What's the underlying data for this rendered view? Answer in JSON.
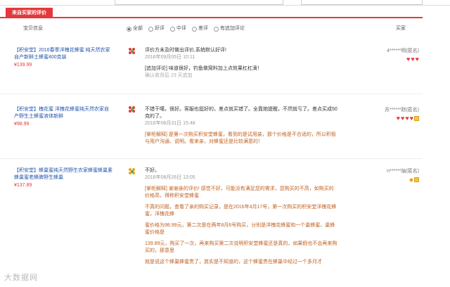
{
  "tab": {
    "label": "来自买家的评价"
  },
  "header": {
    "product_info": "宝贝信息",
    "filters": [
      "全部",
      "好评",
      "中评",
      "差评",
      "有追加评论"
    ],
    "buyer": "买家"
  },
  "reviews": [
    {
      "product_title": "【积安堂】2016春季洋槐花蜂蜜 纯天然农家自产新鲜土蜂蜜400克装",
      "price": "¥139.99",
      "text": "评价方未及时做出评价,系统默认好评!",
      "date": "2016年09月05日 10:11",
      "followup_label": "[追加评论] 味道很好，钓鱼做窝料加上点效果杠杠滴！",
      "followup_meta": "确认收货后 23 天追加",
      "user": "4******明(匿名)"
    },
    {
      "product_title": "【积安堂】槐花蜜 洋槐花蜂蜜纯天然农家自产野生土蜂蜜液体新鲜",
      "price": "¥98.99",
      "text": "不错干噶，很好。客服也挺好的，差点就买错了。全靠她提醒，不然就亏了。差点买成50克的了。",
      "date": "2016年08月31日 15:48",
      "reply": "[掌柜解释] 是第一次购买积安堂蜂蜜，看到的是试用装，那个价格是不合适的，所以积极与用户沟通、说明。看来亲，对蜂蜜还是比较满意的！",
      "user": "苏******踪(匿名)"
    },
    {
      "product_title": "【积安堂】蜂巢蜜纯天然野生农家蜂蜜蜂巢素蜂巢蜜老蜂脾野生蜂巢",
      "price": "¥137.89",
      "text": "不好。",
      "date": "2016年08月26日 13:05",
      "reply": "[掌柜解释] 谢谢亲的评价! 感觉不好，可能没有满足您的需求，您购买的不高，如购买的价格高，得称积安堂蜂蜜",
      "reply_p2": "不真的问题，查看了亲的购买记录，是在2016年4月17号，第一次购买的积安堂洋槐花蜂蜜，洋槐花蜂",
      "reply_p3": "蜜价格为98.99元，第二次是在两年8月6号购买，分别是洋槐花蜂蜜和一个巢蜂蜜，巢蜂蜜价格是",
      "reply_p4": "139.89元，购买了一次，再来购买第二次说明积安堂蜂蜜还是真的，如果假也不会再来购买的，那意思",
      "reply_p5": "就是说这个蜂巢蜂蜜贵了，其实是不知道的，这个蜂蜜贵在蜂巢中经过一个多月才",
      "user": "n******抽(匿名)"
    }
  ],
  "watermark": "大数据网"
}
